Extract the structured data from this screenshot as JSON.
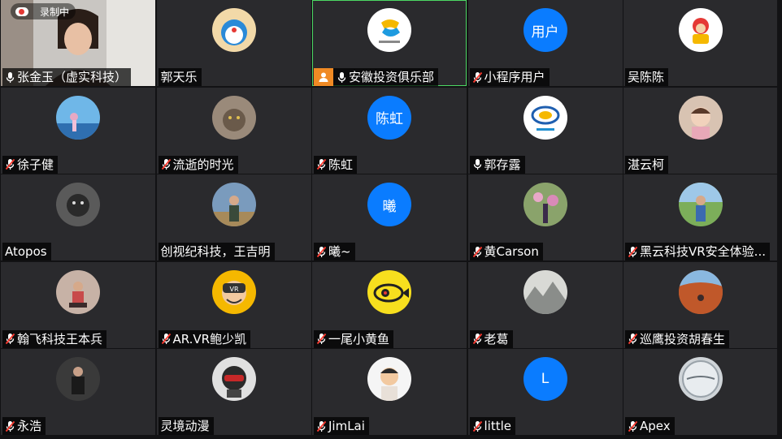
{
  "recording": {
    "label": "录制中"
  },
  "participants": [
    {
      "name": "张金玉（虚实科技）",
      "mic": "on",
      "avatar": {
        "type": "video"
      }
    },
    {
      "name": "郭天乐",
      "mic": "none",
      "avatar": {
        "type": "image",
        "icon": "doraemon-avatar-icon"
      }
    },
    {
      "name": "安徽投资俱乐部",
      "mic": "on",
      "speaking": true,
      "host": true,
      "avatar": {
        "type": "image",
        "icon": "chuangmeng-logo-icon"
      }
    },
    {
      "name": "小程序用户",
      "mic": "muted",
      "avatar": {
        "type": "text",
        "text": "用户",
        "color": "#0a7cff"
      }
    },
    {
      "name": "吴陈陈",
      "mic": "none",
      "avatar": {
        "type": "image",
        "icon": "caishen-avatar-icon"
      }
    },
    {
      "name": "徐子健",
      "mic": "muted",
      "avatar": {
        "type": "image",
        "icon": "blue-sky-avatar-icon"
      }
    },
    {
      "name": "流逝的时光",
      "mic": "muted",
      "avatar": {
        "type": "image",
        "icon": "cat-avatar-icon"
      }
    },
    {
      "name": "陈虹",
      "mic": "muted",
      "avatar": {
        "type": "text",
        "text": "陈虹",
        "color": "#0a7cff"
      }
    },
    {
      "name": "郭存露",
      "mic": "on",
      "avatar": {
        "type": "image",
        "icon": "blue-ring-logo-icon"
      }
    },
    {
      "name": "湛云柯",
      "mic": "none",
      "avatar": {
        "type": "image",
        "icon": "baby-avatar-icon"
      }
    },
    {
      "name": "Atopos",
      "mic": "none",
      "avatar": {
        "type": "image",
        "icon": "dark-cat-avatar-icon"
      }
    },
    {
      "name": "创视纪科技，王吉明",
      "mic": "none",
      "avatar": {
        "type": "image",
        "icon": "person-outdoor-avatar-icon"
      }
    },
    {
      "name": "曦~",
      "mic": "muted",
      "avatar": {
        "type": "text",
        "text": "曦",
        "color": "#0a7cff"
      }
    },
    {
      "name": "黄Carson",
      "mic": "muted",
      "avatar": {
        "type": "image",
        "icon": "flowers-avatar-icon"
      }
    },
    {
      "name": "黑云科技VR安全体验...",
      "mic": "muted",
      "avatar": {
        "type": "image",
        "icon": "person-field-avatar-icon"
      }
    },
    {
      "name": "翰飞科技王本兵",
      "mic": "muted",
      "avatar": {
        "type": "image",
        "icon": "person-sitting-avatar-icon"
      }
    },
    {
      "name": "AR.VR鲍少凯",
      "mic": "muted",
      "avatar": {
        "type": "image",
        "icon": "vr-cartoon-avatar-icon"
      }
    },
    {
      "name": "一尾小黄鱼",
      "mic": "muted",
      "avatar": {
        "type": "image",
        "icon": "yellow-fish-avatar-icon"
      }
    },
    {
      "name": "老葛",
      "mic": "muted",
      "avatar": {
        "type": "image",
        "icon": "ink-landscape-avatar-icon"
      }
    },
    {
      "name": "巡鹰投资胡春生",
      "mic": "muted",
      "avatar": {
        "type": "image",
        "icon": "red-rock-avatar-icon"
      }
    },
    {
      "name": "永浩",
      "mic": "muted",
      "avatar": {
        "type": "image",
        "icon": "person-dark-avatar-icon"
      }
    },
    {
      "name": "灵境动漫",
      "mic": "none",
      "avatar": {
        "type": "image",
        "icon": "helmet-avatar-icon"
      }
    },
    {
      "name": "JimLai",
      "mic": "muted",
      "avatar": {
        "type": "image",
        "icon": "cartoon-man-avatar-icon"
      }
    },
    {
      "name": "little",
      "mic": "muted",
      "avatar": {
        "type": "text",
        "text": "L",
        "color": "#0a7cff"
      }
    },
    {
      "name": "Apex",
      "mic": "muted",
      "avatar": {
        "type": "image",
        "icon": "silver-disc-avatar-icon"
      }
    }
  ]
}
